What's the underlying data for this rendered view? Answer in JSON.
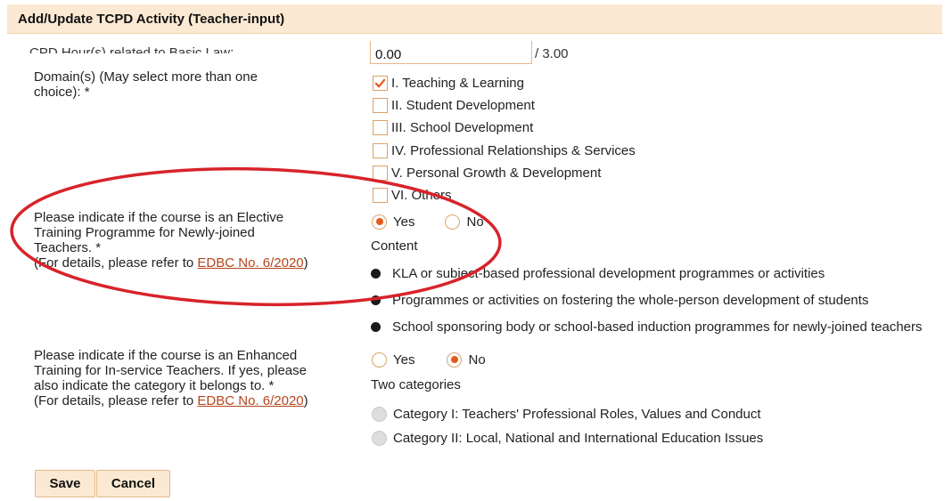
{
  "header": {
    "title": "Add/Update TCPD Activity (Teacher-input)"
  },
  "cpd_hours": {
    "cut_label": "CPD Hour(s) related to Basic Law:",
    "value": "0.00",
    "max_text": "/ 3.00"
  },
  "domains": {
    "label": "Domain(s) (May select more than one choice): *",
    "options": [
      {
        "label": "I. Teaching & Learning",
        "checked": true
      },
      {
        "label": "II. Student Development",
        "checked": false
      },
      {
        "label": "III. School Development",
        "checked": false
      },
      {
        "label": "IV. Professional Relationships & Services",
        "checked": false
      },
      {
        "label": "V. Personal Growth & Development",
        "checked": false
      },
      {
        "label": "VI. Others",
        "checked": false
      }
    ]
  },
  "elective": {
    "label_line1": "Please indicate if the course is an Elective",
    "label_line2": "Training Programme for Newly-joined",
    "label_line3": "Teachers. *",
    "details_prefix": "(For details, please refer to ",
    "details_link": "EDBC No. 6/2020",
    "details_suffix": ")",
    "yes_label": "Yes",
    "no_label": "No",
    "selected": "Yes",
    "content_heading": "Content",
    "content_items": [
      "KLA or subject-based professional development programmes or activities",
      "Programmes or activities on fostering the whole-person development of students",
      "School sponsoring body or school-based induction programmes for newly-joined teachers"
    ]
  },
  "enhanced": {
    "label_line1": "Please indicate if the course is an Enhanced",
    "label_line2": "Training for In-service Teachers. If yes, please",
    "label_line3": "also indicate the category it belongs to. *",
    "details_prefix": "(For details, please refer to ",
    "details_link": "EDBC No. 6/2020",
    "details_suffix": ")",
    "yes_label": "Yes",
    "no_label": "No",
    "selected": "No",
    "categories_heading": "Two categories",
    "categories": [
      "Category I: Teachers' Professional Roles, Values and Conduct",
      "Category II: Local, National and International Education Issues"
    ]
  },
  "buttons": {
    "save": "Save",
    "cancel": "Cancel"
  },
  "colors": {
    "header_bg": "#fce9d3",
    "accent": "#e35b1b",
    "link": "#b5451b",
    "annotation": "#d8232a"
  }
}
